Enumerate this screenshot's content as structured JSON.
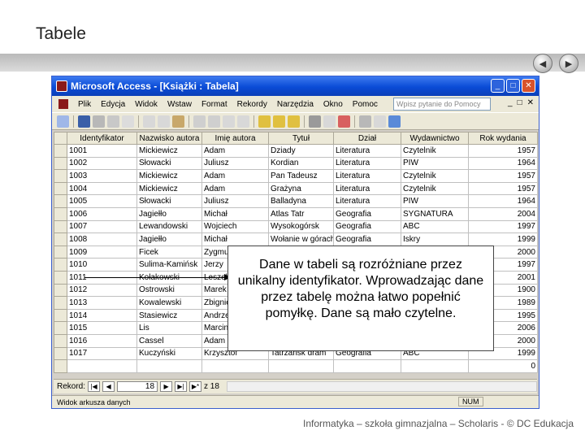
{
  "slide": {
    "title": "Tabele",
    "footer": "Informatyka – szkoła gimnazjalna – Scholaris - © DC Edukacja",
    "nav_prev": "◀",
    "nav_next": "▶"
  },
  "window": {
    "title": "Microsoft Access - [Książki : Tabela]",
    "buttons": {
      "minimize": "_",
      "maximize": "□",
      "close": "✕"
    }
  },
  "menu": {
    "items": [
      "Plik",
      "Edycja",
      "Widok",
      "Wstaw",
      "Format",
      "Rekordy",
      "Narzędzia",
      "Okno",
      "Pomoc"
    ],
    "help_placeholder": "Wpisz pytanie do Pomocy",
    "mdi": {
      "minimize": "_",
      "restore": "□",
      "close": "✕"
    }
  },
  "table": {
    "columns": [
      "Identyfikator",
      "Nazwisko autora",
      "Imię autora",
      "Tytuł",
      "Dział",
      "Wydawnictwo",
      "Rok wydania"
    ],
    "rows": [
      [
        "1001",
        "Mickiewicz",
        "Adam",
        "Dziady",
        "Literatura",
        "Czytelnik",
        "1957"
      ],
      [
        "1002",
        "Słowacki",
        "Juliusz",
        "Kordian",
        "Literatura",
        "PIW",
        "1964"
      ],
      [
        "1003",
        "Mickiewicz",
        "Adam",
        "Pan Tadeusz",
        "Literatura",
        "Czytelnik",
        "1957"
      ],
      [
        "1004",
        "Mickiewicz",
        "Adam",
        "Grażyna",
        "Literatura",
        "Czytelnik",
        "1957"
      ],
      [
        "1005",
        "Słowacki",
        "Juliusz",
        "Balladyna",
        "Literatura",
        "PIW",
        "1964"
      ],
      [
        "1006",
        "Jagiełło",
        "Michał",
        "Atlas Tatr",
        "Geografia",
        "SYGNATURA",
        "2004"
      ],
      [
        "1007",
        "Lewandowski",
        "Wojciech",
        "Wysokogórsk",
        "Geografia",
        "ABC",
        "1997"
      ],
      [
        "1008",
        "Jagiełło",
        "Michał",
        "Wołanie w górach",
        "Geografia",
        "Iskry",
        "1999"
      ],
      [
        "1009",
        "Ficek",
        "Zygmunt",
        "",
        "",
        "",
        "2000"
      ],
      [
        "1010",
        "Sulima-Kamińsk",
        "Jerzy",
        "",
        "",
        "",
        "1997"
      ],
      [
        "1011",
        "Kołakowski",
        "Leszek",
        "",
        "",
        "",
        "2001"
      ],
      [
        "1012",
        "Ostrowski",
        "Marek",
        "",
        "",
        "",
        "1900"
      ],
      [
        "1013",
        "Kowalewski",
        "Zbigniew",
        "",
        "",
        "",
        "1989"
      ],
      [
        "1014",
        "Stasiewicz",
        "Andrzej",
        "",
        "",
        "",
        "1995"
      ],
      [
        "1015",
        "Lis",
        "Marcin",
        "",
        "",
        "",
        "2006"
      ],
      [
        "1016",
        "Cassel",
        "Adam",
        "",
        "",
        "",
        "2000"
      ],
      [
        "1017",
        "Kuczyński",
        "Krzysztof",
        "Tatrzańsk dram",
        "Geografia",
        "ABC",
        "1999"
      ],
      [
        "",
        "",
        "",
        "",
        "",
        "",
        "0"
      ]
    ]
  },
  "record_nav": {
    "label": "Rekord:",
    "current": "18",
    "of_label": "z 18",
    "first": "|◀",
    "prev": "◀",
    "next": "▶",
    "last": "▶|",
    "new": "▶*"
  },
  "status": {
    "text": "Widok arkusza danych",
    "indicator": "NUM"
  },
  "callout": {
    "text": "Dane w tabeli są rozróżniane przez unikalny identyfikator. Wprowadzając dane przez tabelę można łatwo popełnić pomyłkę. Dane są mało czytelne."
  }
}
